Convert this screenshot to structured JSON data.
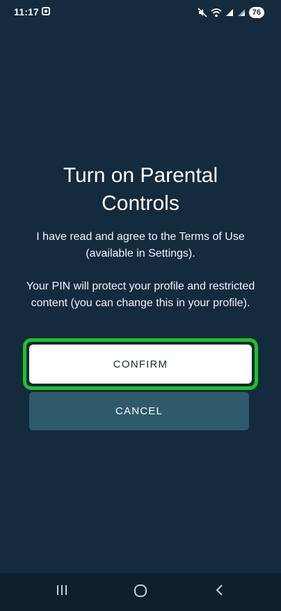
{
  "status_bar": {
    "time": "11:17",
    "battery": "76",
    "icons": [
      "screenshot-icon",
      "mute-icon",
      "wifi-icon",
      "signal-icon",
      "signal-icon",
      "battery-icon"
    ]
  },
  "dialog": {
    "title": "Turn on Parental Controls",
    "terms_text": "I have read and agree to the Terms of Use (available in Settings).",
    "pin_text": "Your PIN will protect your profile and restricted content (you can change this in your profile).",
    "confirm_label": "CONFIRM",
    "cancel_label": "CANCEL"
  },
  "nav_bar": {
    "icons": [
      "recents-icon",
      "home-icon",
      "back-icon"
    ]
  },
  "colors": {
    "background": "#142a3d",
    "confirm_bg": "#ffffff",
    "cancel_bg": "#2e5a6c",
    "highlight": "#1ec51e",
    "nav_bg": "#0e1f2d"
  }
}
